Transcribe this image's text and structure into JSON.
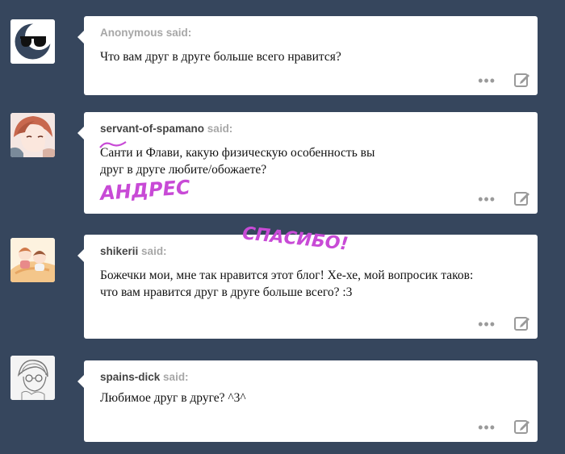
{
  "said_label": "said:",
  "posts": [
    {
      "asker": "Anonymous",
      "question_lines": [
        "Что вам друг в друге больше всего нравится?"
      ],
      "more_label": "•••"
    },
    {
      "asker": "servant-of-spamano",
      "question_lines": [
        "Санти и Флави, какую физическую особенность вы",
        "друг в друге любите/обожаете?"
      ],
      "more_label": "•••"
    },
    {
      "asker": "shikerii",
      "question_lines": [
        "Божечки мои, мне так нравится этот блог! Хе-хе, мой вопросик таков:",
        "что вам нравится друг в друге больше всего? :3"
      ],
      "more_label": "•••"
    },
    {
      "asker": "spains-dick",
      "question_lines": [
        "Любимое друг в друге? ^3^"
      ],
      "more_label": "•••"
    }
  ],
  "annotations": {
    "andres": "АНДРЕС",
    "thanks": "СПАСИБО!"
  },
  "colors": {
    "background": "#36465d",
    "card": "#ffffff",
    "handwriting": "#c84ad6"
  }
}
